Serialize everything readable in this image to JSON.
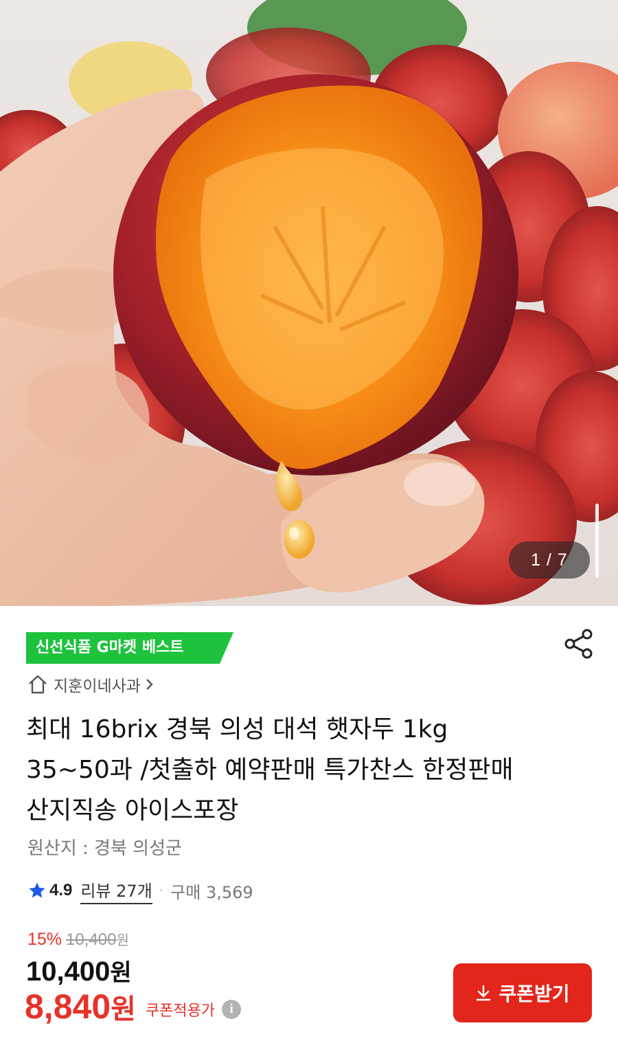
{
  "gallery": {
    "counter": "1 / 7"
  },
  "product": {
    "badge": "신선식품 G마켓 베스트",
    "store_name": "지훈이네사과",
    "title": "최대 16brix 경북 의성 대석 햇자두 1kg 35~50과 /첫출하 예약판매 특가찬스 한정판매 산지직송 아이스포장",
    "origin": "원산지 : 경북 의성군",
    "rating": "4.9",
    "review_label": "리뷰 27개",
    "dot": "·",
    "purchase_count": "구매 3,569"
  },
  "pricing": {
    "discount_percent": "15%",
    "original_price": "10,400",
    "original_unit": "원",
    "price": "10,400",
    "price_unit": "원",
    "coupon_price": "8,840",
    "coupon_unit": "원",
    "coupon_applied_label": "쿠폰적용가",
    "info_icon_glyph": "i"
  },
  "actions": {
    "coupon_button_label": "쿠폰받기"
  },
  "icons": {
    "home": "home-icon",
    "chevron": "chevron-right-icon",
    "share": "share-icon",
    "star": "star-icon",
    "download": "download-icon",
    "info": "info-icon"
  },
  "colors": {
    "badge_green": "#1ec23d",
    "accent_red": "#e3261b",
    "rating_star": "#1f5ae8"
  }
}
